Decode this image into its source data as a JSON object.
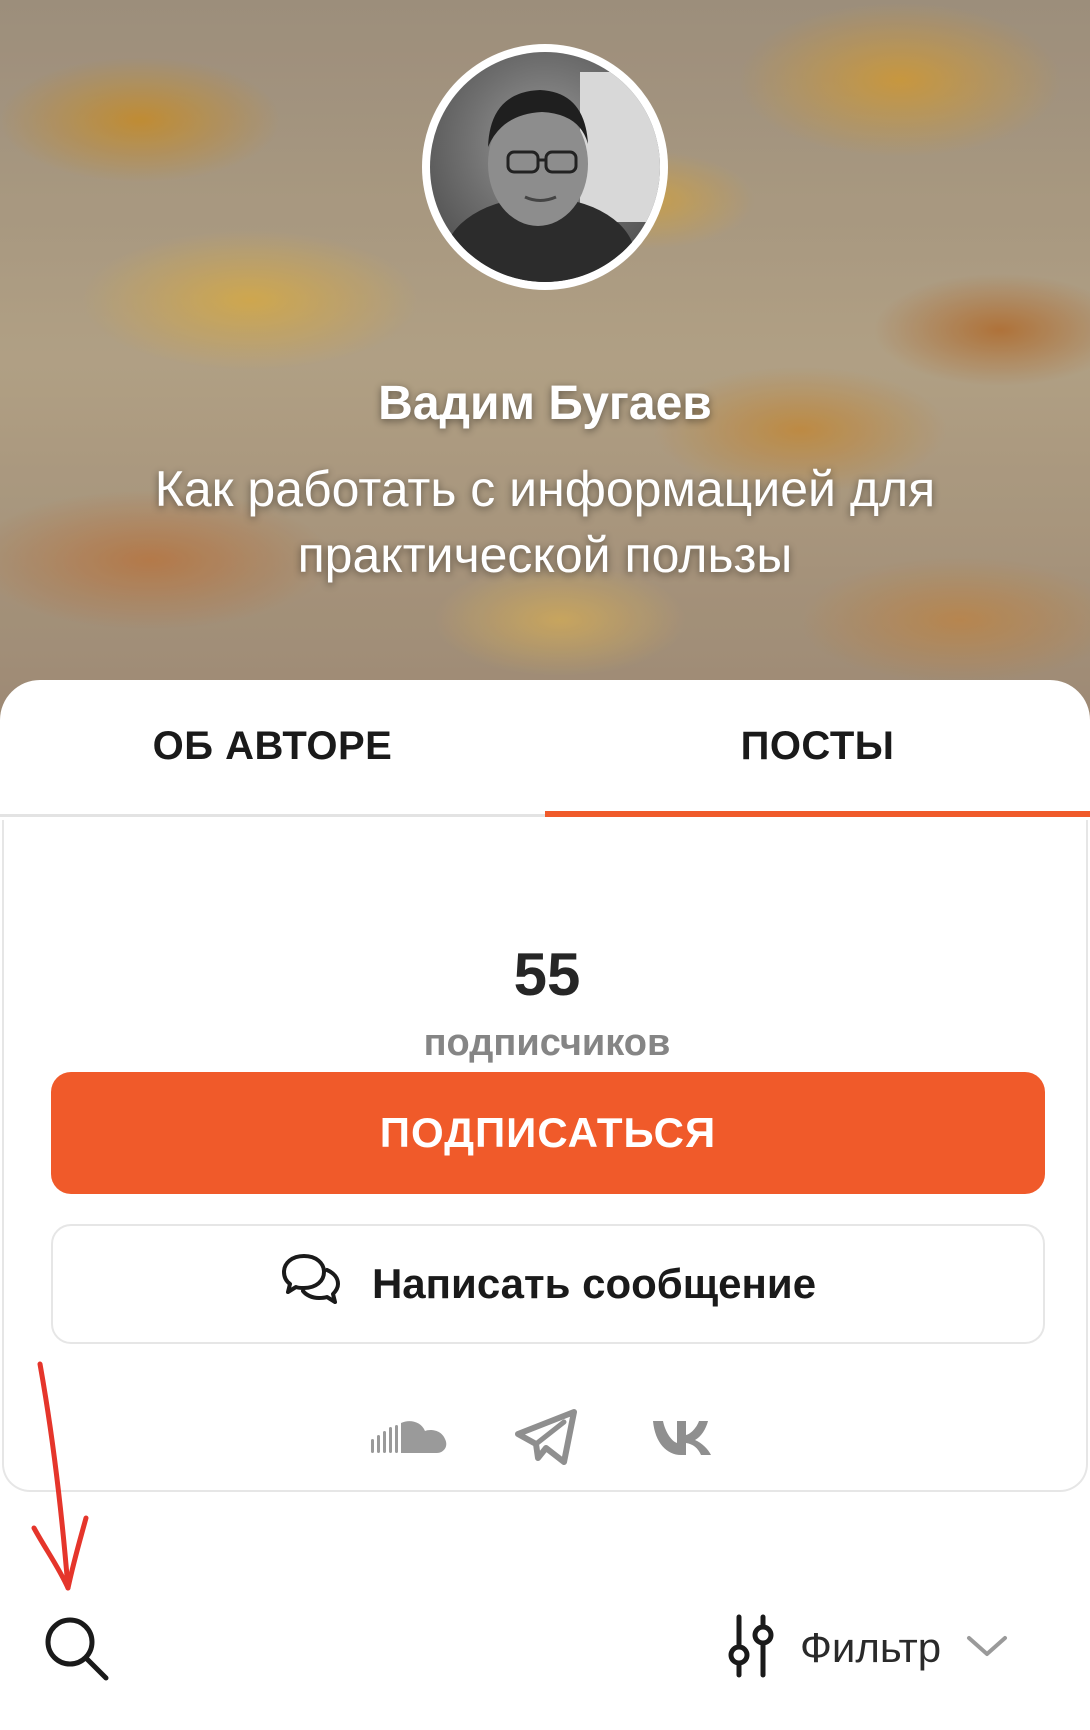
{
  "profile": {
    "name": "Вадим Бугаев",
    "tagline": "Как работать с информацией для практической пользы"
  },
  "tabs": [
    {
      "label": "ОБ АВТОРЕ",
      "active": false
    },
    {
      "label": "ПОСТЫ",
      "active": true
    }
  ],
  "stats": {
    "subscribers_count": "55",
    "subscribers_label": "подписчиков"
  },
  "actions": {
    "subscribe_label": "ПОДПИСАТЬСЯ",
    "message_label": "Написать сообщение"
  },
  "social_links": [
    "soundcloud-icon",
    "telegram-icon",
    "vk-icon"
  ],
  "toolbar": {
    "filter_label": "Фильтр"
  },
  "colors": {
    "accent": "#f05a2a",
    "text": "#1a1a1a",
    "muted": "#858585",
    "annotation": "#e5352b"
  }
}
